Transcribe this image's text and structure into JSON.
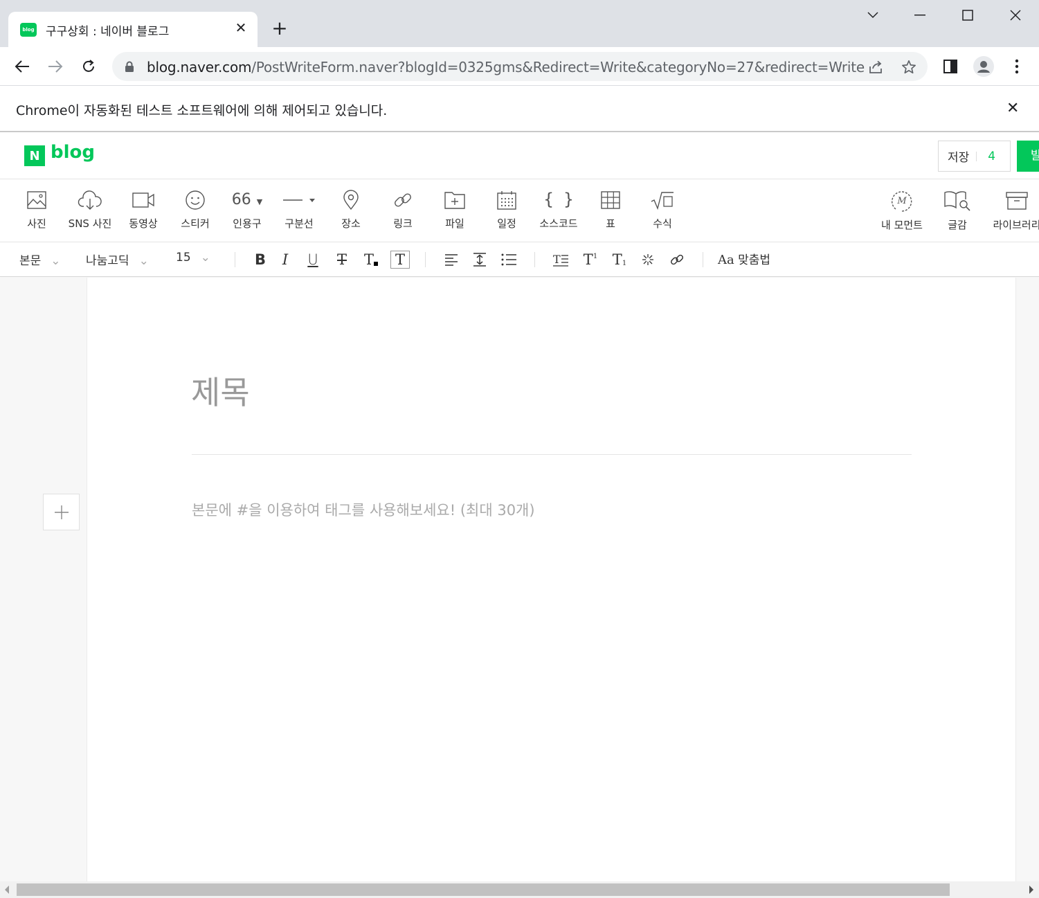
{
  "browser": {
    "tab_title": "구구상회 : 네이버 블로그",
    "favicon_text": "blog",
    "url_host": "blog.naver.com",
    "url_path": "/PostWriteForm.naver?blogId=0325gms&Redirect=Write&categoryNo=27&redirect=Write",
    "infobar_text": "Chrome이 자동화된 테스트 소프트웨어에 의해 제어되고 있습니다."
  },
  "header": {
    "logo_letter": "N",
    "logo_word": "blog",
    "save_label": "저장",
    "save_count": "4",
    "publish_label": "발"
  },
  "insert_toolbar": {
    "items": [
      {
        "label": "사진",
        "icon": "photo-icon"
      },
      {
        "label": "SNS 사진",
        "icon": "cloud-download-icon"
      },
      {
        "label": "동영상",
        "icon": "video-icon"
      },
      {
        "label": "스티커",
        "icon": "smile-icon"
      },
      {
        "label": "인용구",
        "icon": "quote-icon"
      },
      {
        "label": "구분선",
        "icon": "divider-icon"
      },
      {
        "label": "장소",
        "icon": "map-pin-icon"
      },
      {
        "label": "링크",
        "icon": "link-icon"
      },
      {
        "label": "파일",
        "icon": "folder-plus-icon"
      },
      {
        "label": "일정",
        "icon": "calendar-icon"
      },
      {
        "label": "소스코드",
        "icon": "code-braces-icon"
      },
      {
        "label": "표",
        "icon": "table-icon"
      },
      {
        "label": "수식",
        "icon": "formula-icon"
      },
      {
        "label": "내 모먼트",
        "icon": "moment-icon"
      },
      {
        "label": "글감",
        "icon": "book-search-icon"
      },
      {
        "label": "라이브러리",
        "icon": "archive-icon"
      }
    ],
    "quote_glyph": "66"
  },
  "format_toolbar": {
    "paragraph_style": "본문",
    "font_family": "나눔고딕",
    "font_size": "15",
    "bold": "B",
    "italic": "I",
    "underline": "U",
    "strike": "T",
    "text_color": "T",
    "bg_color": "T",
    "superscript": "T",
    "subscript": "T",
    "spellcheck_label": "맞춤법"
  },
  "editor": {
    "title_placeholder": "제목",
    "body_placeholder": "본문에 #을 이용하여 태그를 사용해보세요! (최대 30개)"
  },
  "colors": {
    "brand_green": "#03c75a",
    "placeholder_gray": "#999999"
  }
}
